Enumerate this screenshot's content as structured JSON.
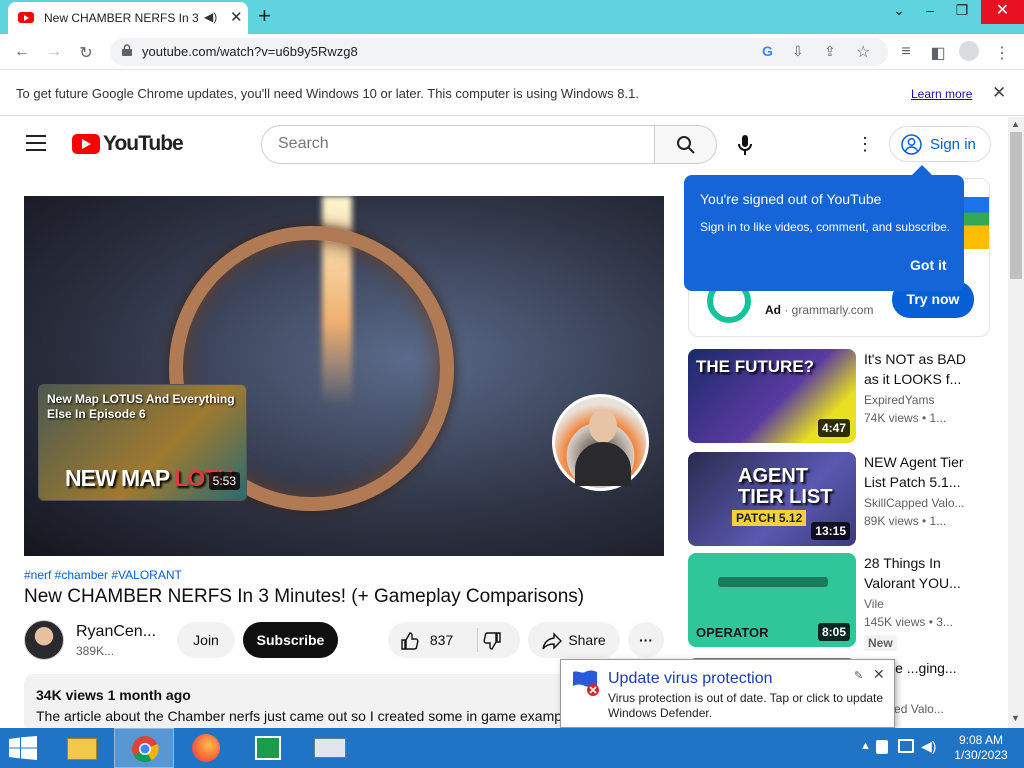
{
  "browser": {
    "tab_title": "New CHAMBER NERFS In 3 M",
    "new_tab": "+",
    "url": "youtube.com/watch?v=u6b9y5Rwzg8"
  },
  "infobar": {
    "message": "To get future Google Chrome updates, you'll need Windows 10 or later. This computer is using Windows 8.1.",
    "link": "Learn more"
  },
  "header": {
    "logo_text": "YouTube",
    "search_placeholder": "Search",
    "signin_label": "Sign in"
  },
  "video": {
    "endcard_title": "New Map LOTUS And Everything Else In Episode 6",
    "endcard_big_text_1": "NEW MAP ",
    "endcard_big_text_2": "LOTU",
    "endcard_duration": "5:53",
    "hashtags": "#nerf #chamber #VALORANT",
    "title": "New CHAMBER NERFS In 3 Minutes! (+ Gameplay Comparisons)",
    "channel_name": "RyanCen...",
    "channel_subs": "389K...",
    "join_label": "Join",
    "subscribe_label": "Subscribe",
    "like_count": "837",
    "share_label": "Share",
    "more_label": "···",
    "desc_meta": "34K views  1 month ago",
    "desc_text": "The article about the Chamber nerfs just came out so I created some in game examp"
  },
  "tooltip": {
    "heading": "You're signed out of YouTube",
    "body": "Sign in to like videos, comment, and subscribe.",
    "button": "Got it"
  },
  "ad": {
    "label": "Ad",
    "domain": "grammarly.com",
    "cta": "Try now"
  },
  "related": [
    {
      "title": "It's NOT as BAD as it LOOKS f...",
      "channel": "ExpiredYams",
      "views": "74K views  • 1...",
      "duration": "4:47",
      "thumb_text": "THE FUTURE?"
    },
    {
      "title": "NEW Agent Tier List Patch 5.1...",
      "channel": "SkillCapped Valo...",
      "views": "89K views  • 1...",
      "duration": "13:15",
      "thumb_text": "AGENT TIER LIST",
      "thumb_sub": "PATCH 5.12"
    },
    {
      "title": "28 Things In Valorant YOU...",
      "channel": "Vile",
      "views": "145K views  • 3...",
      "duration": "8:05",
      "thumb_text": "OPERATOR",
      "badge": "New"
    },
    {
      "title": "...ame ...ging...",
      "channel": "...apped Valo..."
    }
  ],
  "defender": {
    "title": "Update virus protection",
    "body": "Virus protection is out of date. Tap or click to update Windows Defender."
  },
  "taskbar": {
    "time": "9:08 AM",
    "date": "1/30/2023"
  },
  "colors": {
    "chrome_frame": "#5fd4df",
    "youtube_red": "#ff0000",
    "link_blue": "#065fd4",
    "taskbar": "#1f74c5"
  }
}
